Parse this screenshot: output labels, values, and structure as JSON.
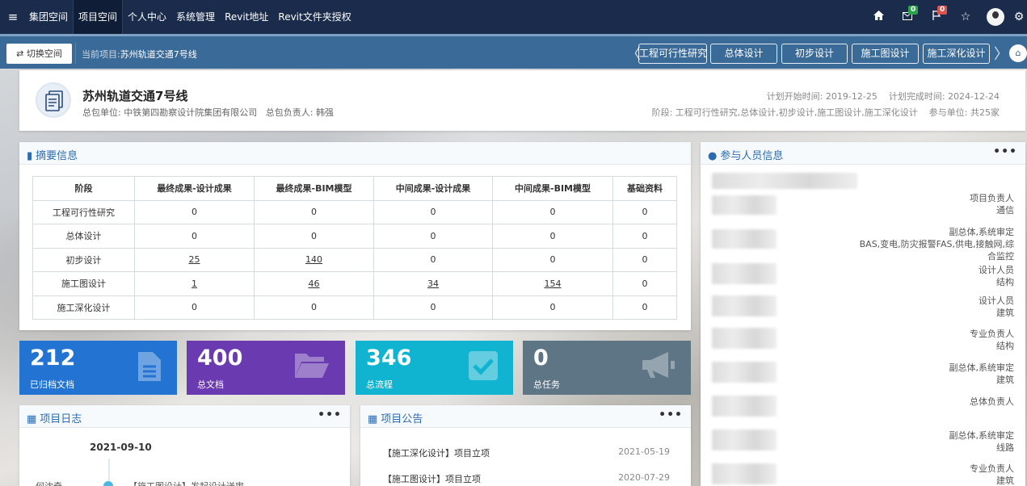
{
  "nav": {
    "items": [
      "集团空间",
      "项目空间",
      "个人中心",
      "系统管理",
      "Revit地址",
      "Revit文件夹授权"
    ],
    "mail_badge": "0",
    "flag_badge": "0"
  },
  "subbar": {
    "switch_label": "⇄ 切换空间",
    "current_label": "当前项目:",
    "current_project": "苏州轨道交通7号线",
    "stages": [
      "工程可行性研究",
      "总体设计",
      "初步设计",
      "施工图设计",
      "施工深化设计"
    ]
  },
  "project": {
    "title": "苏州轨道交通7号线",
    "contractor_label": "总包单位:",
    "contractor": "中铁第四勘察设计院集团有限公司",
    "owner_label": "总包负责人:",
    "owner": "韩强",
    "plan_start_label": "计划开始时间:",
    "plan_start": "2019-12-25",
    "plan_end_label": "计划完成时间:",
    "plan_end": "2024-12-24",
    "stage_label": "阶段:",
    "stages": "工程可行性研究,总体设计,初步设计,施工图设计,施工深化设计",
    "units_label": "参与单位:",
    "units": "共25家"
  },
  "summary": {
    "title": "摘要信息",
    "headers": [
      "阶段",
      "最终成果-设计成果",
      "最终成果-BIM模型",
      "中间成果-设计成果",
      "中间成果-BIM模型",
      "基础资料"
    ],
    "rows": [
      [
        "工程可行性研究",
        "0",
        "0",
        "0",
        "0",
        "0"
      ],
      [
        "总体设计",
        "0",
        "0",
        "0",
        "0",
        "0"
      ],
      [
        "初步设计",
        "25",
        "140",
        "0",
        "0",
        "0"
      ],
      [
        "施工图设计",
        "1",
        "46",
        "34",
        "154",
        "0"
      ],
      [
        "施工深化设计",
        "0",
        "0",
        "0",
        "0",
        "0"
      ]
    ]
  },
  "stats": [
    {
      "value": "212",
      "label": "已归档文档",
      "color": "#2374d2",
      "icon": "file-icon"
    },
    {
      "value": "400",
      "label": "总文档",
      "color": "#6a3ab0",
      "icon": "folder-open-icon"
    },
    {
      "value": "346",
      "label": "总流程",
      "color": "#10b4d0",
      "icon": "check-square-icon"
    },
    {
      "value": "0",
      "label": "总任务",
      "color": "#5d7585",
      "icon": "megaphone-icon"
    }
  ],
  "people": {
    "title": "参与人员信息",
    "entries": [
      [
        "项目负责人",
        "通信"
      ],
      [
        "副总体,系统审定",
        "BAS,变电,防灾报警FAS,供电,接触网,综",
        "合监控"
      ],
      [
        "设计人员",
        "结构"
      ],
      [
        "设计人员",
        "建筑"
      ],
      [
        "专业负责人",
        "结构"
      ],
      [
        "副总体,系统审定",
        "建筑"
      ],
      [
        "总体负责人"
      ],
      [
        "副总体,系统审定",
        "线路"
      ],
      [
        "专业负责人",
        "建筑"
      ]
    ]
  },
  "log": {
    "title": "项目日志",
    "date": "2021-09-10",
    "name": "何沈奇",
    "text": "【施工图设计】发起设计送审"
  },
  "notices": {
    "title": "项目公告",
    "items": [
      {
        "text": "【施工深化设计】项目立项",
        "date": "2021-05-19"
      },
      {
        "text": "【施工图设计】项目立项",
        "date": "2020-07-29"
      }
    ]
  }
}
